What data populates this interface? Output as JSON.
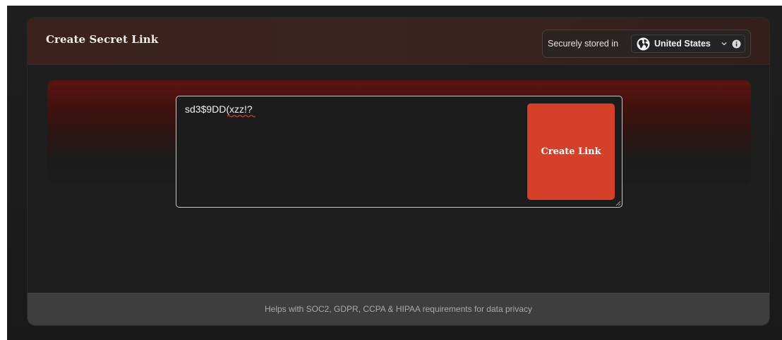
{
  "header": {
    "title": "Create Secret Link",
    "region_prefix": "Securely stored in",
    "region_selected": "United States",
    "region_icon": "globe-icon",
    "info_icon": "info-icon"
  },
  "form": {
    "secret_value": "sd3$9DD(xzz!?",
    "submit_label": "Create Link"
  },
  "footer": {
    "note": "Helps with SOC2, GDPR, CCPA & HIPAA requirements for data privacy"
  },
  "colors": {
    "accent": "#d4402a",
    "header_bg": "#3a2420",
    "footer_bg": "#3e3e3e",
    "body_bg": "#1e1e1e"
  }
}
